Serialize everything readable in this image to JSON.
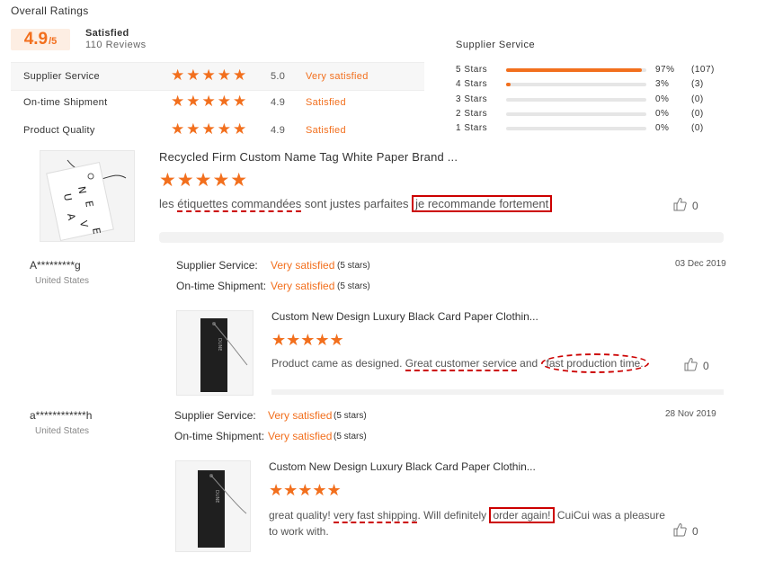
{
  "overall": {
    "heading": "Overall Ratings",
    "score": "4.9",
    "score_suffix": "/5",
    "label": "Satisfied",
    "reviews": "110 Reviews"
  },
  "ratings": [
    {
      "label": "Supplier Service",
      "score": "5.0",
      "text": "Very satisfied",
      "stars": 5
    },
    {
      "label": "On-time Shipment",
      "score": "4.9",
      "text": "Satisfied",
      "stars": 5
    },
    {
      "label": "Product Quality",
      "score": "4.9",
      "text": "Satisfied",
      "stars": 5
    }
  ],
  "distribution": {
    "title": "Supplier Service",
    "rows": [
      {
        "label": "5 Stars",
        "fraction": 0.97,
        "pct": "97%",
        "count": "(107)"
      },
      {
        "label": "4 Stars",
        "fraction": 0.03,
        "pct": "3%",
        "count": "(3)"
      },
      {
        "label": "3 Stars",
        "fraction": 0,
        "pct": "0%",
        "count": "(0)"
      },
      {
        "label": "2 Stars",
        "fraction": 0,
        "pct": "0%",
        "count": "(0)"
      },
      {
        "label": "1 Stars",
        "fraction": 0,
        "pct": "0%",
        "count": "(0)"
      }
    ]
  },
  "review1": {
    "product": "Recycled Firm Custom Name Tag White Paper Brand ...",
    "stars": "★★★★★",
    "text_a": "les ",
    "text_b": "étiquettes commandées",
    "text_c": " sont justes parfaites ",
    "text_d": "je recommande fortement",
    "likes": "0"
  },
  "review2": {
    "user": "A*********g",
    "country": "United States",
    "date": "03 Dec 2019",
    "supplier_label": "Supplier Service:",
    "supplier_val": "Very satisfied",
    "supplier_paren": "(5 stars)",
    "shipment_label": "On-time Shipment:",
    "shipment_val": "Very satisfied",
    "shipment_paren": "(5 stars)",
    "product": "Custom New Design Luxury Black Card Paper Clothin...",
    "stars": "★★★★★",
    "text_a": "Product came as designed. ",
    "text_b": "Great customer service",
    "text_c": " and ",
    "text_d": "fast production time.",
    "likes": "0"
  },
  "review3": {
    "user": "a************h",
    "country": "United States",
    "date": "28 Nov 2019",
    "supplier_label": "Supplier Service:",
    "supplier_val": "Very satisfied",
    "supplier_paren": "(5 stars)",
    "shipment_label": "On-time Shipment:",
    "shipment_val": "Very satisfied",
    "shipment_paren": "(5 stars)",
    "product": "Custom New Design Luxury Black Card Paper Clothin...",
    "stars": "★★★★★",
    "text_a": "great quality! ",
    "text_b": "very fast shipping",
    "text_c": ". Will definitely ",
    "text_d": "order again!",
    "text_e": " CuiCui was a pleasure",
    "text_f": "to work with.",
    "likes": "0"
  },
  "colors": {
    "accent": "#f26f1d",
    "highlight": "#cc0000"
  },
  "icons": {
    "like": "thumbs-up-icon",
    "star": "star-icon"
  }
}
